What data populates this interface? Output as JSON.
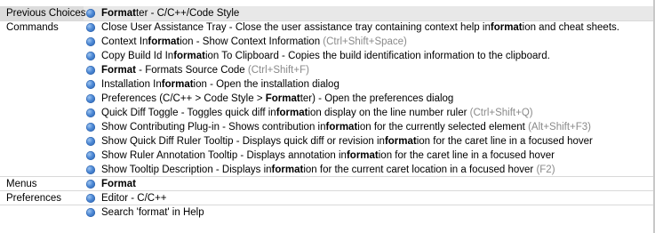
{
  "groups": {
    "previous_choices": "Previous Choices",
    "commands": "Commands",
    "menus": "Menus",
    "preferences": "Preferences"
  },
  "rows": [
    {
      "pre": "",
      "hl": "Format",
      "post": "ter - C/C++/Code Style",
      "key": ""
    },
    {
      "pre": "Close User Assistance Tray - Close the user assistance tray containing context help in",
      "hl": "format",
      "post": "ion and cheat sheets.",
      "key": ""
    },
    {
      "pre": "Context In",
      "hl": "format",
      "post": "ion - Show Context Information",
      "key": "(Ctrl+Shift+Space)"
    },
    {
      "pre": "Copy Build Id In",
      "hl": "format",
      "post": "ion To Clipboard - Copies the build identification information to the clipboard.",
      "key": ""
    },
    {
      "pre": "",
      "hl": "Format",
      "post": " - Formats Source Code",
      "key": "(Ctrl+Shift+F)"
    },
    {
      "pre": "Installation In",
      "hl": "format",
      "post": "ion - Open the installation dialog",
      "key": ""
    },
    {
      "pre": "Preferences (C/C++ > Code Style > ",
      "hl": "Format",
      "post": "ter) - Open the preferences dialog",
      "key": ""
    },
    {
      "pre": "Quick Diff Toggle - Toggles quick diff in",
      "hl": "format",
      "post": "ion display on the line number ruler",
      "key": "(Ctrl+Shift+Q)"
    },
    {
      "pre": "Show Contributing Plug-in - Shows contribution in",
      "hl": "format",
      "post": "ion for the currently selected element",
      "key": "(Alt+Shift+F3)"
    },
    {
      "pre": "Show Quick Diff Ruler Tooltip - Displays quick diff or revision in",
      "hl": "format",
      "post": "ion for the caret line in a focused hover",
      "key": ""
    },
    {
      "pre": "Show Ruler Annotation Tooltip - Displays annotation in",
      "hl": "format",
      "post": "ion for the caret line in a focused hover",
      "key": ""
    },
    {
      "pre": "Show Tooltip Description - Displays in",
      "hl": "format",
      "post": "ion for the current caret location in a focused hover",
      "key": "(F2)"
    },
    {
      "pre": "",
      "hl": "Format",
      "post": "",
      "key": ""
    },
    {
      "pre": "Editor - C/C++",
      "hl": "",
      "post": "",
      "key": ""
    },
    {
      "pre": "Search 'format' in Help",
      "hl": "",
      "post": "",
      "key": ""
    }
  ],
  "bullet_color": "#4a86d4",
  "selection_color": "#e8e8e8"
}
